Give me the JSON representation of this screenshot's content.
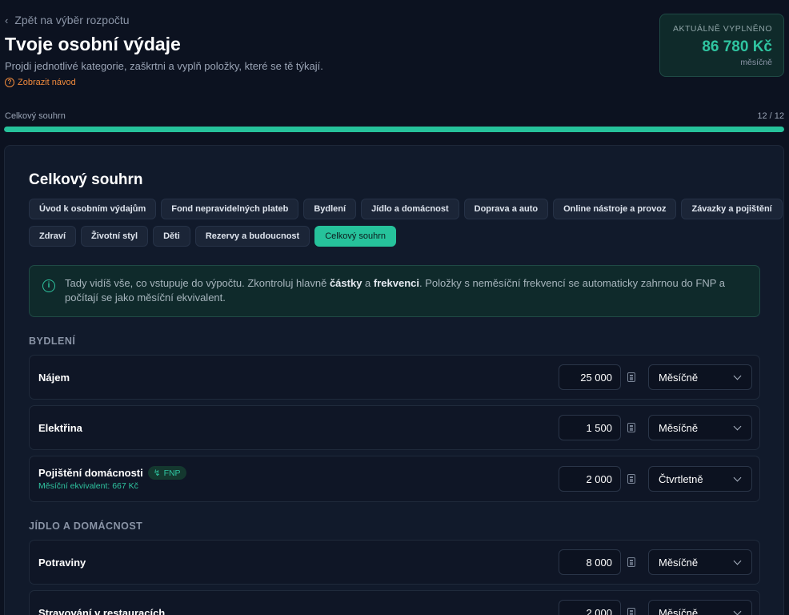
{
  "header": {
    "back_label": "Zpět na výběr rozpočtu",
    "title": "Tvoje osobní výdaje",
    "subtitle": "Projdi jednotlivé kategorie, zaškrtni a vyplň položky, které se tě týkají.",
    "guide_label": "Zobrazit návod"
  },
  "filled_card": {
    "label": "AKTUÁLNĚ VYPLNĚNO",
    "amount": "86 780 Kč",
    "period": "měsíčně"
  },
  "progress": {
    "label": "Celkový souhrn",
    "count": "12 / 12",
    "fraction": 1.0,
    "color": "#26c29b"
  },
  "panel": {
    "title": "Celkový souhrn",
    "tabs_row1": [
      "Úvod k osobním výdajům",
      "Fond nepravidelných plateb",
      "Bydlení",
      "Jídlo a domácnost",
      "Doprava a auto",
      "Online nástroje a provoz",
      "Závazky a pojištění"
    ],
    "tabs_row2": [
      "Zdraví",
      "Životní styl",
      "Děti",
      "Rezervy a budoucnost",
      "Celkový souhrn"
    ],
    "active_tab": "Celkový souhrn",
    "info": {
      "part1": "Tady vidíš vše, co vstupuje do výpočtu. Zkontroluj hlavně ",
      "bold1": "částky",
      "part2": " a ",
      "bold2": "frekvenci",
      "part3": ". Položky s neměsíční frekvencí se automaticky zahrnou do FNP a počítají se jako měsíční ekvivalent."
    }
  },
  "sections": {
    "housing": {
      "heading": "BYDLENÍ",
      "items": [
        {
          "label": "Nájem",
          "amount": "25 000",
          "frequency": "Měsíčně"
        },
        {
          "label": "Elektřina",
          "amount": "1 500",
          "frequency": "Měsíčně"
        },
        {
          "label": "Pojištění domácnosti",
          "badge": "FNP",
          "sub": "Měsíční ekvivalent: 667 Kč",
          "amount": "2 000",
          "frequency": "Čtvrtletně"
        }
      ]
    },
    "food": {
      "heading": "JÍDLO A DOMÁCNOST",
      "items": [
        {
          "label": "Potraviny",
          "amount": "8 000",
          "frequency": "Měsíčně"
        },
        {
          "label": "Stravování v restauracích",
          "amount": "2 000",
          "frequency": "Měsíčně"
        }
      ]
    }
  },
  "icons": {
    "back": "chevron-left-icon",
    "guide": "question-circle-icon",
    "info": "info-circle-icon",
    "badge": "bolt-icon",
    "calculator": "calculator-icon",
    "select": "chevron-down-icon"
  }
}
